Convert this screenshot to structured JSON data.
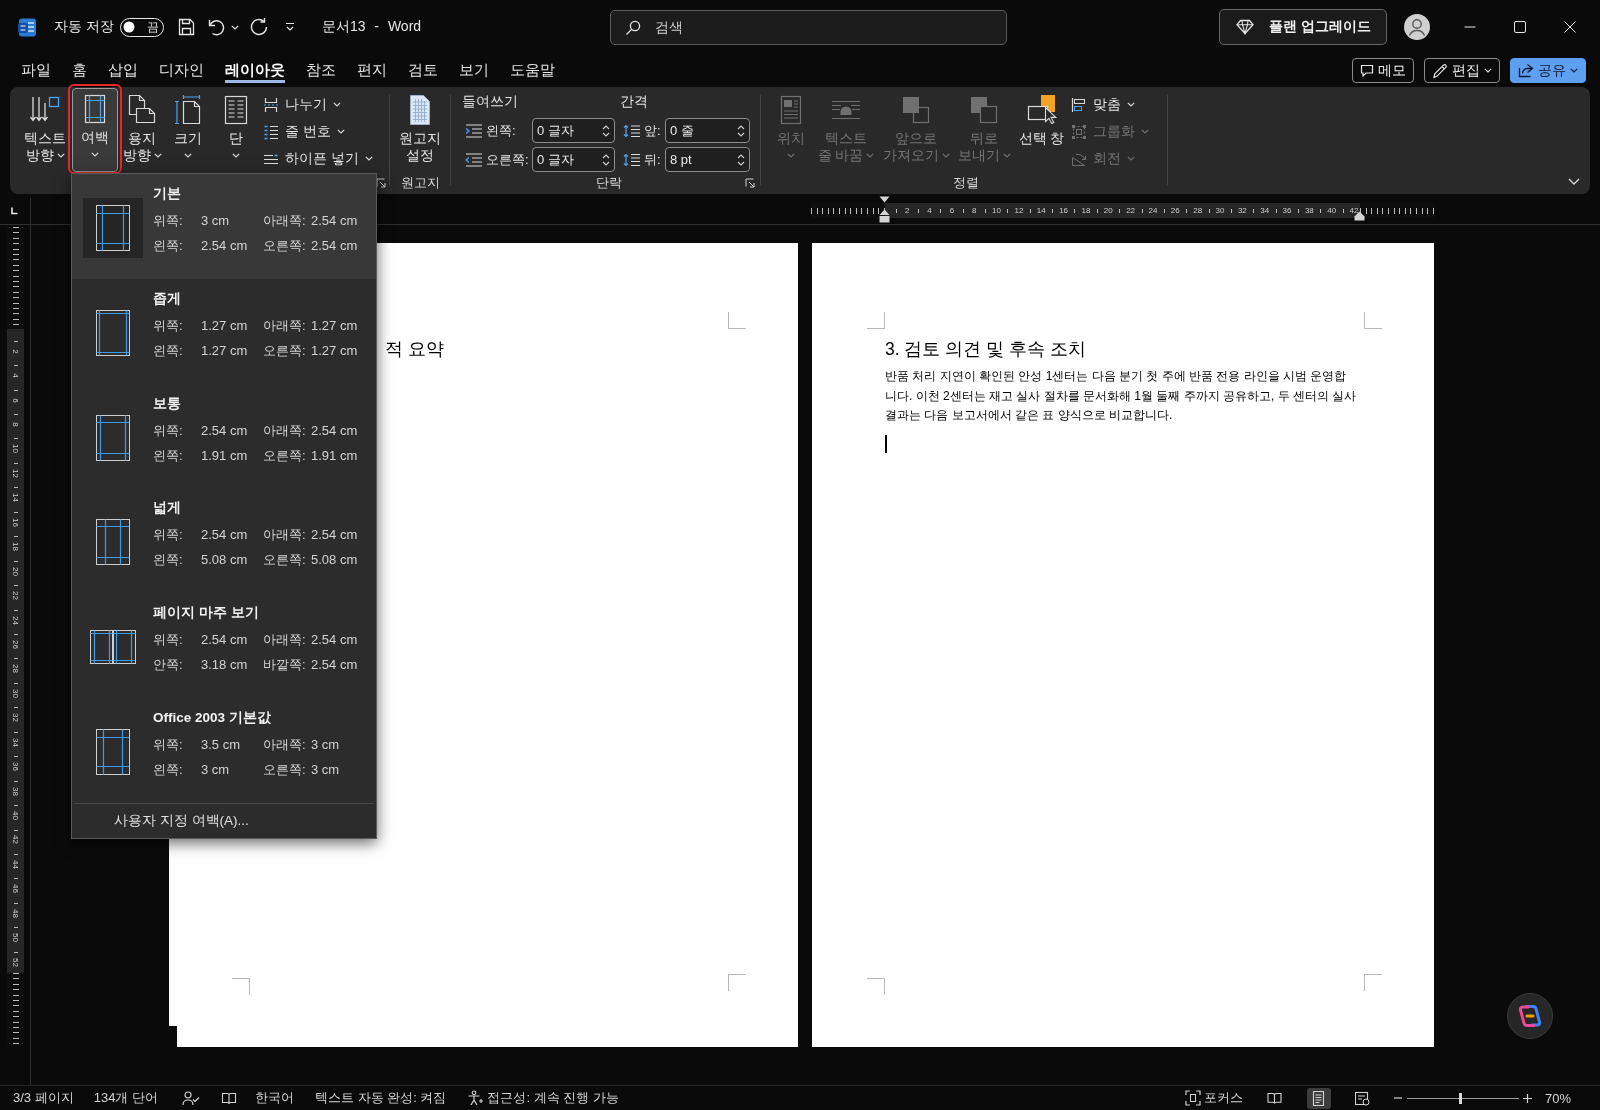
{
  "title_bar": {
    "autosave_label": "자동 저장",
    "autosave": {
      "on": false,
      "label": "끔"
    },
    "title": "문서13 - Word",
    "search": {
      "placeholder": "검색"
    },
    "upgrade": "플랜 업그레이드"
  },
  "tabs": [
    {
      "label": "파일",
      "selected": false
    },
    {
      "label": "홈",
      "selected": false
    },
    {
      "label": "삽입",
      "selected": false
    },
    {
      "label": "디자인",
      "selected": false
    },
    {
      "label": "레이아웃",
      "selected": true
    },
    {
      "label": "참조",
      "selected": false
    },
    {
      "label": "편지",
      "selected": false
    },
    {
      "label": "검토",
      "selected": false
    },
    {
      "label": "보기",
      "selected": false
    },
    {
      "label": "도움말",
      "selected": false
    }
  ],
  "actions": [
    {
      "kind": "comments",
      "label": "메모",
      "dropdown": false
    },
    {
      "kind": "editing",
      "label": "편집",
      "dropdown": true
    },
    {
      "kind": "share",
      "label": "공유",
      "dropdown": true
    }
  ],
  "ribbon": {
    "groups": [
      {
        "kind": "page-setup",
        "launcher": true,
        "buttons": [
          {
            "kind": "text-direction",
            "lines": [
              "텍스트",
              "방향"
            ],
            "dropdown": true,
            "disabled": false,
            "expanded": false,
            "highlighted": false
          },
          {
            "kind": "margins",
            "lines": [
              "여백"
            ],
            "dropdown": true,
            "disabled": false,
            "expanded": true,
            "highlighted": true
          },
          {
            "kind": "orientation",
            "lines": [
              "용지",
              "방향"
            ],
            "dropdown": true,
            "disabled": false,
            "expanded": false,
            "highlighted": false
          },
          {
            "kind": "size",
            "lines": [
              "크기"
            ],
            "dropdown": true,
            "disabled": false,
            "expanded": false,
            "highlighted": false
          },
          {
            "kind": "columns",
            "lines": [
              "단"
            ],
            "dropdown": true,
            "disabled": false,
            "expanded": false,
            "highlighted": false
          }
        ],
        "small_buttons": [
          {
            "kind": "breaks",
            "label": "나누기",
            "dropdown": true,
            "disabled": false
          },
          {
            "kind": "line-numbers",
            "label": "줄 번호",
            "dropdown": true,
            "disabled": false
          },
          {
            "kind": "hyphenation",
            "label": "하이픈 넣기",
            "dropdown": true,
            "disabled": false
          }
        ]
      },
      {
        "kind": "manuscript",
        "label": "원고지",
        "launcher": false,
        "buttons": [
          {
            "kind": "manuscript-setup",
            "lines": [
              "원고지",
              "설정"
            ],
            "dropdown": false,
            "disabled": false,
            "expanded": false,
            "highlighted": false
          }
        ]
      },
      {
        "kind": "paragraph",
        "label": "단락",
        "launcher": true,
        "columns": [
          {
            "title": "들여쓰기",
            "fields": [
              {
                "kind": "indent-left",
                "label": "왼쪽:",
                "value": "0 글자"
              },
              {
                "kind": "indent-right",
                "label": "오른쪽:",
                "value": "0 글자"
              }
            ]
          },
          {
            "title": "간격",
            "fields": [
              {
                "kind": "spacing-before",
                "label": "앞:",
                "value": "0 줄"
              },
              {
                "kind": "spacing-after",
                "label": "뒤:",
                "value": "8 pt"
              }
            ]
          }
        ]
      },
      {
        "kind": "arrange",
        "label": "정렬",
        "launcher": false,
        "buttons": [
          {
            "kind": "position",
            "lines": [
              "위치"
            ],
            "dropdown": true,
            "disabled": true,
            "expanded": false,
            "highlighted": false
          },
          {
            "kind": "wrap-text",
            "lines": [
              "텍스트",
              "줄 바꿈"
            ],
            "dropdown": true,
            "disabled": true,
            "expanded": false,
            "highlighted": false
          },
          {
            "kind": "bring-forward",
            "lines": [
              "앞으로",
              "가져오기"
            ],
            "dropdown": true,
            "disabled": true,
            "expanded": false,
            "highlighted": false
          },
          {
            "kind": "send-backward",
            "lines": [
              "뒤로",
              "보내기"
            ],
            "dropdown": true,
            "disabled": true,
            "expanded": false,
            "highlighted": false
          },
          {
            "kind": "selection-pane",
            "lines": [
              "선택 창"
            ],
            "dropdown": false,
            "disabled": false,
            "expanded": false,
            "highlighted": false
          }
        ],
        "small_buttons": [
          {
            "kind": "align",
            "label": "맞춤",
            "dropdown": true,
            "disabled": false
          },
          {
            "kind": "group",
            "label": "그룹화",
            "dropdown": true,
            "disabled": true
          },
          {
            "kind": "rotate",
            "label": "회전",
            "dropdown": true,
            "disabled": true
          }
        ]
      }
    ]
  },
  "margins_menu": {
    "items": [
      {
        "kind": "normal",
        "title": "기본",
        "selected": true,
        "rows": [
          [
            {
              "label": "위쪽:",
              "value": "3 cm"
            },
            {
              "label": "아래쪽:",
              "value": "2.54 cm"
            }
          ],
          [
            {
              "label": "왼쪽:",
              "value": "2.54 cm"
            },
            {
              "label": "오른쪽:",
              "value": "2.54 cm"
            }
          ]
        ]
      },
      {
        "kind": "narrow",
        "title": "좁게",
        "selected": false,
        "rows": [
          [
            {
              "label": "위쪽:",
              "value": "1.27 cm"
            },
            {
              "label": "아래쪽:",
              "value": "1.27 cm"
            }
          ],
          [
            {
              "label": "왼쪽:",
              "value": "1.27 cm"
            },
            {
              "label": "오른쪽:",
              "value": "1.27 cm"
            }
          ]
        ]
      },
      {
        "kind": "moderate",
        "title": "보통",
        "selected": false,
        "rows": [
          [
            {
              "label": "위쪽:",
              "value": "2.54 cm"
            },
            {
              "label": "아래쪽:",
              "value": "2.54 cm"
            }
          ],
          [
            {
              "label": "왼쪽:",
              "value": "1.91 cm"
            },
            {
              "label": "오른쪽:",
              "value": "1.91 cm"
            }
          ]
        ]
      },
      {
        "kind": "wide",
        "title": "넓게",
        "selected": false,
        "rows": [
          [
            {
              "label": "위쪽:",
              "value": "2.54 cm"
            },
            {
              "label": "아래쪽:",
              "value": "2.54 cm"
            }
          ],
          [
            {
              "label": "왼쪽:",
              "value": "5.08 cm"
            },
            {
              "label": "오른쪽:",
              "value": "5.08 cm"
            }
          ]
        ]
      },
      {
        "kind": "mirrored",
        "title": "페이지 마주 보기",
        "selected": false,
        "rows": [
          [
            {
              "label": "위쪽:",
              "value": "2.54 cm"
            },
            {
              "label": "아래쪽:",
              "value": "2.54 cm"
            }
          ],
          [
            {
              "label": "안쪽:",
              "value": "3.18 cm"
            },
            {
              "label": "바깥쪽:",
              "value": "2.54 cm"
            }
          ]
        ]
      },
      {
        "kind": "office2003",
        "title": "Office 2003 기본값",
        "selected": false,
        "rows": [
          [
            {
              "label": "위쪽:",
              "value": "3.5 cm"
            },
            {
              "label": "아래쪽:",
              "value": "3 cm"
            }
          ],
          [
            {
              "label": "왼쪽:",
              "value": "3 cm"
            },
            {
              "label": "오른쪽:",
              "value": "3 cm"
            }
          ]
        ]
      }
    ],
    "footer": "사용자 지정 여백(A)..."
  },
  "ruler": {
    "labels": [
      "2",
      "4",
      "6",
      "8",
      "10",
      "12",
      "14",
      "16",
      "18",
      "20",
      "22",
      "24",
      "26",
      "28",
      "30",
      "32",
      "34",
      "36",
      "38",
      "40",
      "42"
    ]
  },
  "vertical_ruler": {
    "labels": [
      "2",
      "4",
      "6",
      "8",
      "10",
      "12",
      "14",
      "16",
      "18",
      "20",
      "22",
      "24",
      "26",
      "28",
      "30",
      "32",
      "34",
      "36",
      "38",
      "40",
      "42",
      "44",
      "46",
      "48",
      "50",
      "52"
    ]
  },
  "pages": [
    {
      "kind": "covered",
      "heading": "적 요약",
      "cursor": false
    },
    {
      "kind": "full",
      "heading": "3. 검토 의견 및 후속 조치",
      "body_lines": [
        "반품 처리 지연이 확인된 안성 1센터는 다음 분기 첫 주에 반품 전용 라인을 시범 운영합",
        "니다. 이천 2센터는 재고 실사 절차를 문서화해 1월 둘째 주까지 공유하고, 두 센터의 실사",
        "결과는 다음 보고서에서 같은 표 양식으로 비교합니다."
      ],
      "cursor": true
    }
  ],
  "status_bar": {
    "page": "3/3 페이지",
    "words": "134개 단어",
    "language": "한국어",
    "autocomplete": "텍스트 자동 완성: 켜짐",
    "accessibility": "접근성: 계속 진행 가능",
    "focus": "포커스",
    "views": [
      {
        "kind": "read",
        "selected": false
      },
      {
        "kind": "print",
        "selected": true
      },
      {
        "kind": "web",
        "selected": false
      }
    ],
    "zoom": {
      "level": 0.48,
      "label": "70%"
    }
  }
}
